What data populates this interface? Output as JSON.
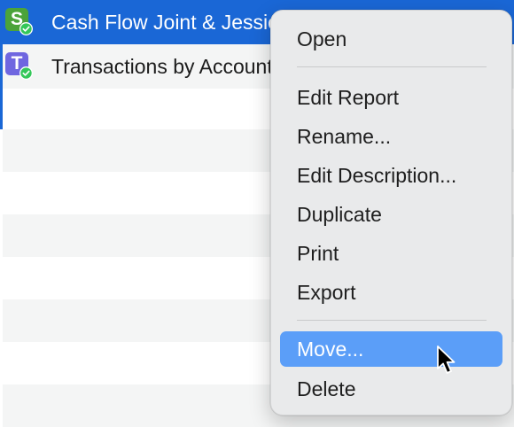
{
  "files": [
    {
      "label": "Cash Flow Joint & Jessica",
      "icon_letter": "S",
      "icon_color": "#4ba33a",
      "icon": "spreadsheet-icon",
      "selected": true
    },
    {
      "label": "Transactions by Account",
      "icon_letter": "T",
      "icon_color": "#6f66e0",
      "icon": "transactions-icon",
      "selected": false
    }
  ],
  "context_menu": {
    "items": [
      {
        "label": "Open"
      },
      {
        "label": "Edit Report"
      },
      {
        "label": "Rename..."
      },
      {
        "label": "Edit Description..."
      },
      {
        "label": "Duplicate"
      },
      {
        "label": "Print"
      },
      {
        "label": "Export"
      },
      {
        "label": "Move..."
      },
      {
        "label": "Delete"
      }
    ],
    "highlighted": "Move...",
    "highlight_color": "#5b9ef8"
  },
  "colors": {
    "selection": "#1a67d6",
    "stripe": "#f4f5f5",
    "sync_check": "#34c759"
  }
}
